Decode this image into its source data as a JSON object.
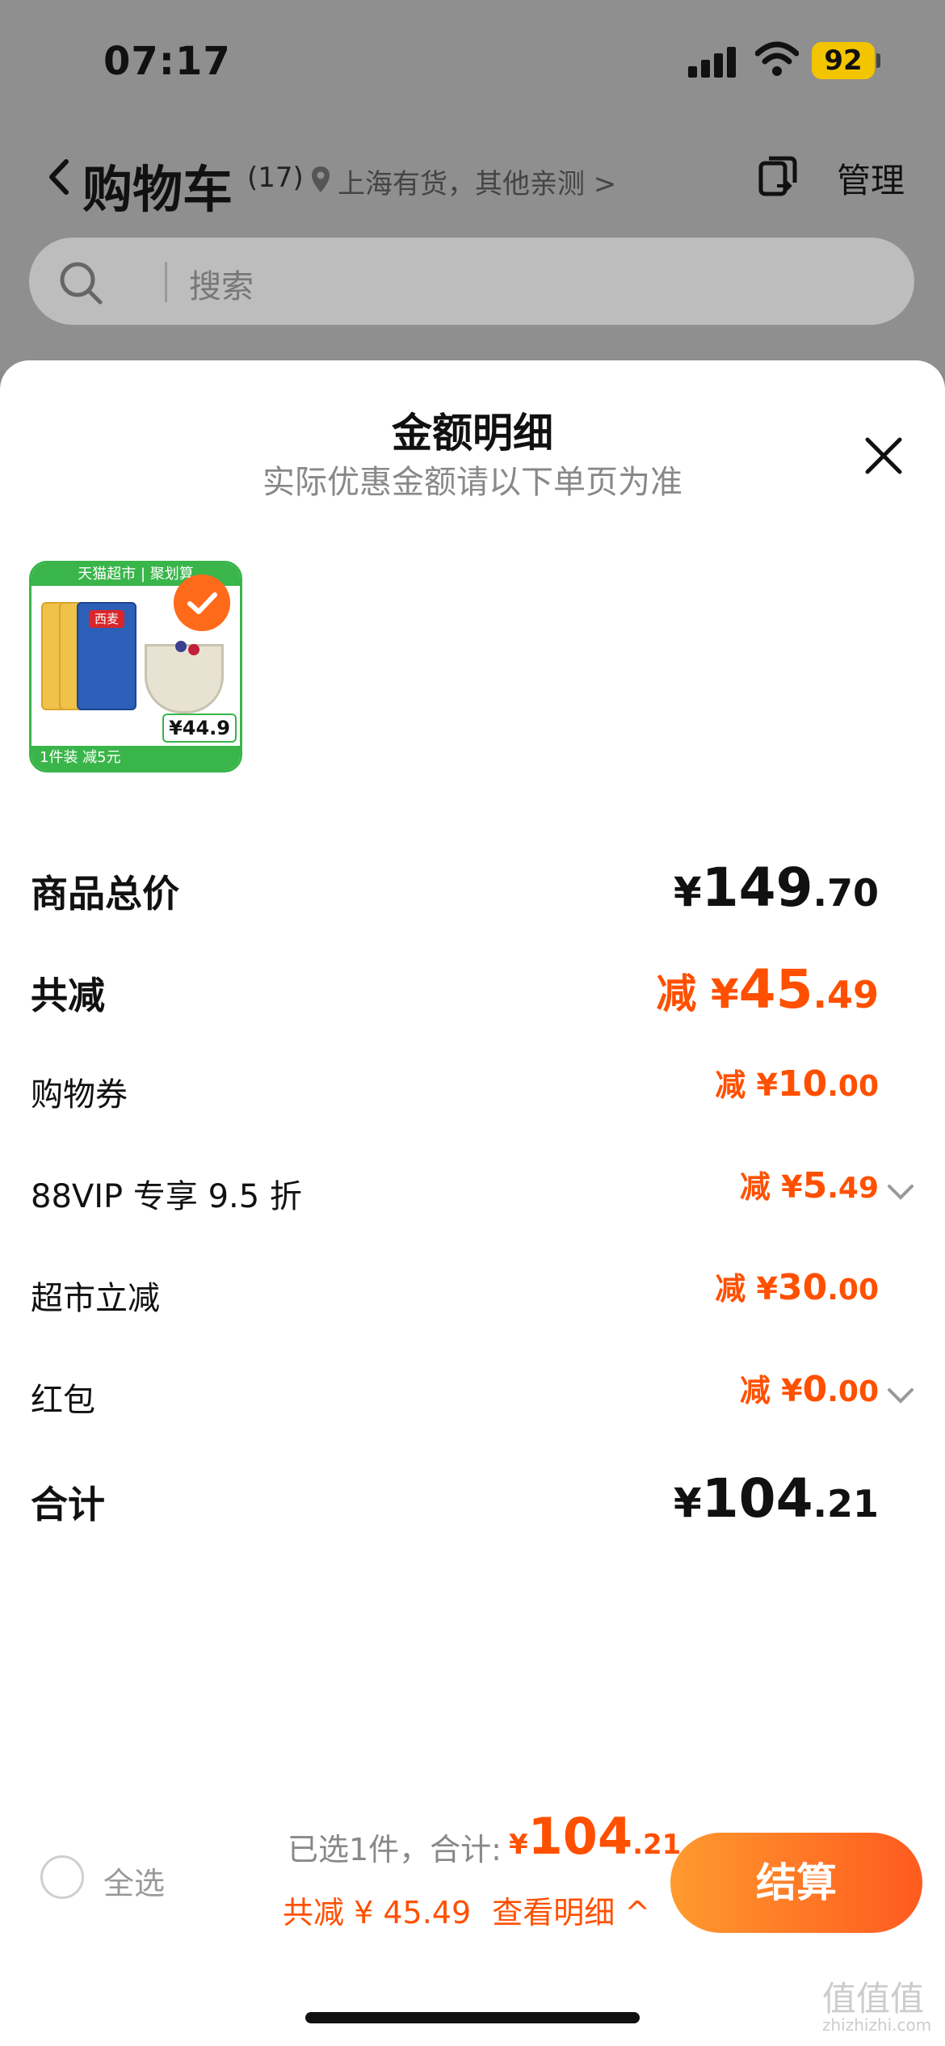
{
  "status_bar": {
    "time": "07:17",
    "battery": "92"
  },
  "nav": {
    "title": "购物车",
    "count": "(17)",
    "location": "上海有货，其他亲测 >",
    "manage": "管理"
  },
  "search": {
    "placeholder": "搜索"
  },
  "sheet": {
    "title": "金额明细",
    "subtitle": "实际优惠金额请以下单页为准"
  },
  "product": {
    "top_banner": "天猫超市 | 聚划算",
    "promo": "1件装 减5元",
    "price": "¥44.9",
    "brand": "西麦"
  },
  "rows": [
    {
      "label": "商品总价",
      "prefix": "",
      "yen": "¥",
      "int": "149",
      "dec": ".70",
      "color": "#111111",
      "style": "big",
      "chevron": false
    },
    {
      "label": "共减",
      "prefix": "减 ",
      "yen": "¥",
      "int": "45",
      "dec": ".49",
      "color": "#ff5000",
      "style": "big",
      "chevron": false
    },
    {
      "label": "购物券",
      "prefix": "减 ",
      "yen": "¥",
      "int": "10",
      "dec": ".00",
      "color": "#ff5000",
      "style": "small",
      "chevron": false
    },
    {
      "label": "88VIP 专享 9.5 折",
      "prefix": "减 ",
      "yen": "¥",
      "int": "5",
      "dec": ".49",
      "color": "#ff5000",
      "style": "small",
      "chevron": true
    },
    {
      "label": "超市立减",
      "prefix": "减 ",
      "yen": "¥",
      "int": "30",
      "dec": ".00",
      "color": "#ff5000",
      "style": "small",
      "chevron": false
    },
    {
      "label": "红包",
      "prefix": "减 ",
      "yen": "¥",
      "int": "0",
      "dec": ".00",
      "color": "#ff5000",
      "style": "small",
      "chevron": true
    },
    {
      "label": "合计",
      "prefix": "",
      "yen": "¥",
      "int": "104",
      "dec": ".21",
      "color": "#111111",
      "style": "big",
      "chevron": false
    }
  ],
  "bottom": {
    "select_all": "全选",
    "selected_text": "已选1件，合计:",
    "total_yen": "¥",
    "total_int": "104",
    "total_dec": ".21",
    "discount_text": "共减 ¥ 45.49",
    "detail_link": "查看明细 ^",
    "checkout": "结算"
  },
  "watermark": {
    "main": "值值值",
    "sub": "zhizhizhi.com"
  }
}
